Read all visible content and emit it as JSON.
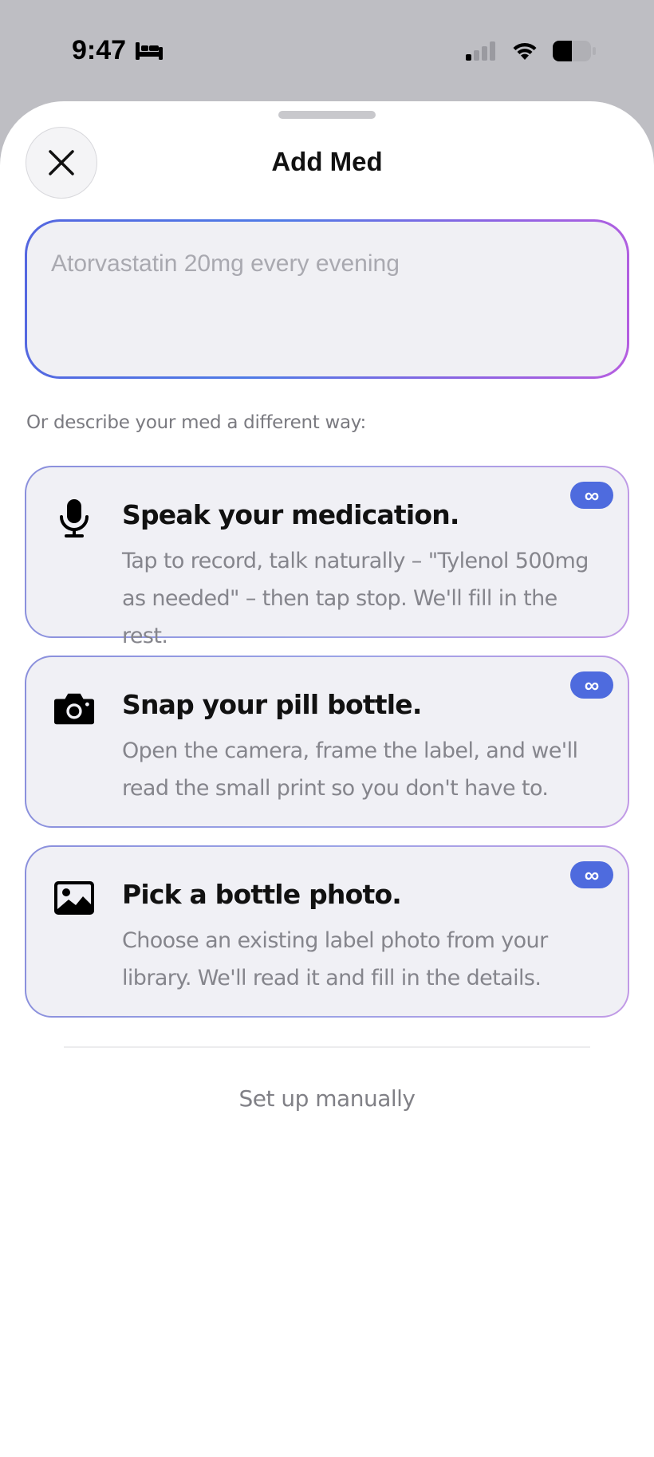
{
  "status_bar": {
    "time": "9:47",
    "icons": [
      "bed-icon",
      "cellular-signal-icon",
      "wifi-icon",
      "battery-icon"
    ]
  },
  "sheet": {
    "title": "Add Med",
    "close_icon": "close-icon"
  },
  "med_input": {
    "value": "",
    "placeholder": "Atorvastatin 20mg every evening"
  },
  "alt_label": "Or describe your med a different way:",
  "options": [
    {
      "icon": "microphone-icon",
      "title": "Speak your medication.",
      "description": "Tap to record, talk naturally – \"Tylenol 500mg as needed\" – then tap stop. We'll fill in the rest.",
      "badge": "∞"
    },
    {
      "icon": "camera-icon",
      "title": "Snap your pill bottle.",
      "description": "Open the camera, frame the label, and we'll read the small print so you don't have to.",
      "badge": "∞"
    },
    {
      "icon": "photo-icon",
      "title": "Pick a bottle photo.",
      "description": "Choose an existing label photo from your library. We'll read it and fill in the details.",
      "badge": "∞"
    }
  ],
  "manual_link": "Set up manually",
  "colors": {
    "accent_blue": "#4e6bde",
    "gradient_start": "#5466e0",
    "gradient_end": "#b65ee0",
    "card_bg": "#f0f0f5"
  }
}
